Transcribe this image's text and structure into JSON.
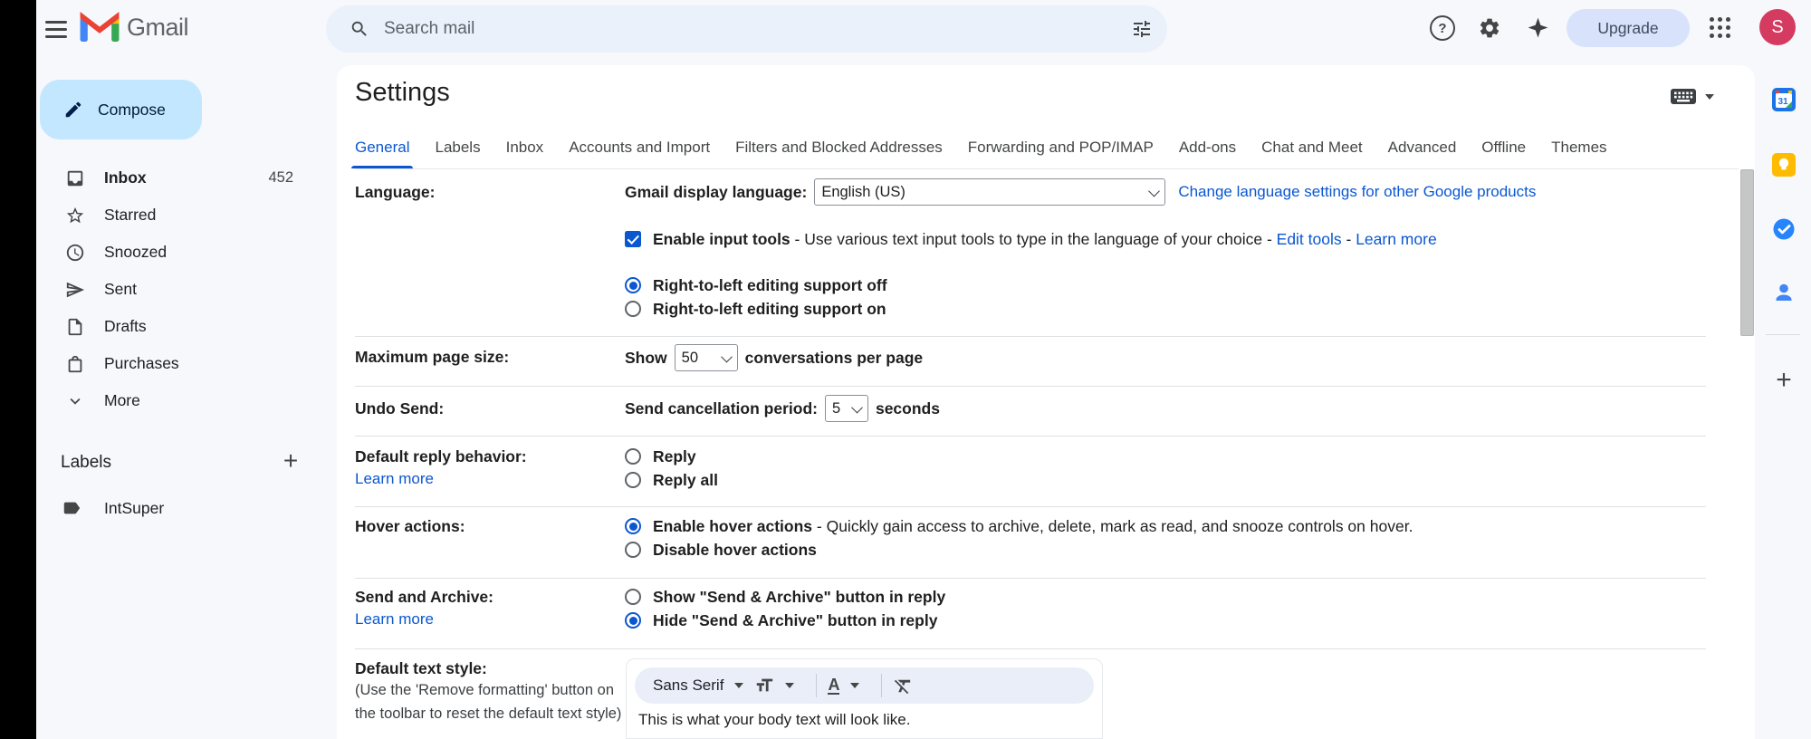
{
  "topbar": {
    "brand": "Gmail",
    "search_placeholder": "Search mail",
    "upgrade_label": "Upgrade",
    "avatar_initial": "S"
  },
  "sidebar": {
    "compose_label": "Compose",
    "items": [
      {
        "label": "Inbox",
        "count": "452"
      },
      {
        "label": "Starred"
      },
      {
        "label": "Snoozed"
      },
      {
        "label": "Sent"
      },
      {
        "label": "Drafts"
      },
      {
        "label": "Purchases"
      },
      {
        "label": "More"
      }
    ],
    "labels_header": "Labels",
    "labels": [
      {
        "label": "IntSuper"
      }
    ]
  },
  "settings": {
    "title": "Settings",
    "tabs": [
      {
        "label": "General",
        "active": true
      },
      {
        "label": "Labels"
      },
      {
        "label": "Inbox"
      },
      {
        "label": "Accounts and Import"
      },
      {
        "label": "Filters and Blocked Addresses"
      },
      {
        "label": "Forwarding and POP/IMAP"
      },
      {
        "label": "Add-ons"
      },
      {
        "label": "Chat and Meet"
      },
      {
        "label": "Advanced"
      },
      {
        "label": "Offline"
      },
      {
        "label": "Themes"
      }
    ],
    "language": {
      "row_label": "Language:",
      "display_label": "Gmail display language:",
      "display_value": "English (US)",
      "change_link": "Change language settings for other Google products",
      "input_tools_bold": "Enable input tools",
      "input_tools_checked": true,
      "input_tools_rest": " - Use various text input tools to type in the language of your choice - ",
      "edit_tools_link": "Edit tools",
      "sep": " - ",
      "learn_more_link": "Learn more",
      "rtl_off": "Right-to-left editing support off",
      "rtl_off_selected": true,
      "rtl_on": "Right-to-left editing support on"
    },
    "max_page_size": {
      "row_label": "Maximum page size:",
      "show_label": "Show",
      "value": "50",
      "suffix": "conversations per page"
    },
    "undo_send": {
      "row_label": "Undo Send:",
      "prefix": "Send cancellation period:",
      "value": "5",
      "suffix": "seconds"
    },
    "default_reply": {
      "row_label": "Default reply behavior:",
      "learn_more": "Learn more",
      "reply": "Reply",
      "reply_all": "Reply all"
    },
    "hover_actions": {
      "row_label": "Hover actions:",
      "enable_bold": "Enable hover actions",
      "enable_rest": " - Quickly gain access to archive, delete, mark as read, and snooze controls on hover.",
      "enable_selected": true,
      "disable": "Disable hover actions"
    },
    "send_archive": {
      "row_label": "Send and Archive:",
      "learn_more": "Learn more",
      "show": "Show \"Send & Archive\" button in reply",
      "hide": "Hide \"Send & Archive\" button in reply",
      "hide_selected": true
    },
    "text_style": {
      "row_label": "Default text style:",
      "note_line1": "(Use the 'Remove formatting' button on",
      "note_line2": "the toolbar to reset the default text style)",
      "font_name": "Sans Serif",
      "preview": "This is what your body text will look like."
    }
  },
  "companion": {
    "calendar_day": "31"
  },
  "colors": {
    "accent": "#0b57d0",
    "compose_bg": "#c2e7ff",
    "search_bg": "#eaf1fb",
    "upgrade_bg": "#d8e2fb",
    "avatar_bg": "#d53b61",
    "page_bg": "#f6f8fc"
  },
  "icons": {
    "topbar": [
      "hamburger-menu-icon",
      "gmail-logo",
      "search-icon",
      "tune-filter-icon",
      "help-icon",
      "gear-icon",
      "gemini-sparkle-icon",
      "apps-grid-icon"
    ],
    "sidebar": [
      "pencil-icon",
      "inbox-icon",
      "star-icon",
      "clock-icon",
      "send-icon",
      "draft-icon",
      "purchases-bag-icon",
      "chevron-down-icon",
      "plus-icon",
      "label-tag-icon"
    ],
    "main": [
      "keyboard-input-tools-icon",
      "dropdown-caret-icon",
      "font-size-icon",
      "text-color-icon",
      "remove-formatting-icon"
    ],
    "companion": [
      "calendar-icon",
      "keep-icon",
      "tasks-icon",
      "contacts-icon",
      "plus-icon"
    ]
  }
}
